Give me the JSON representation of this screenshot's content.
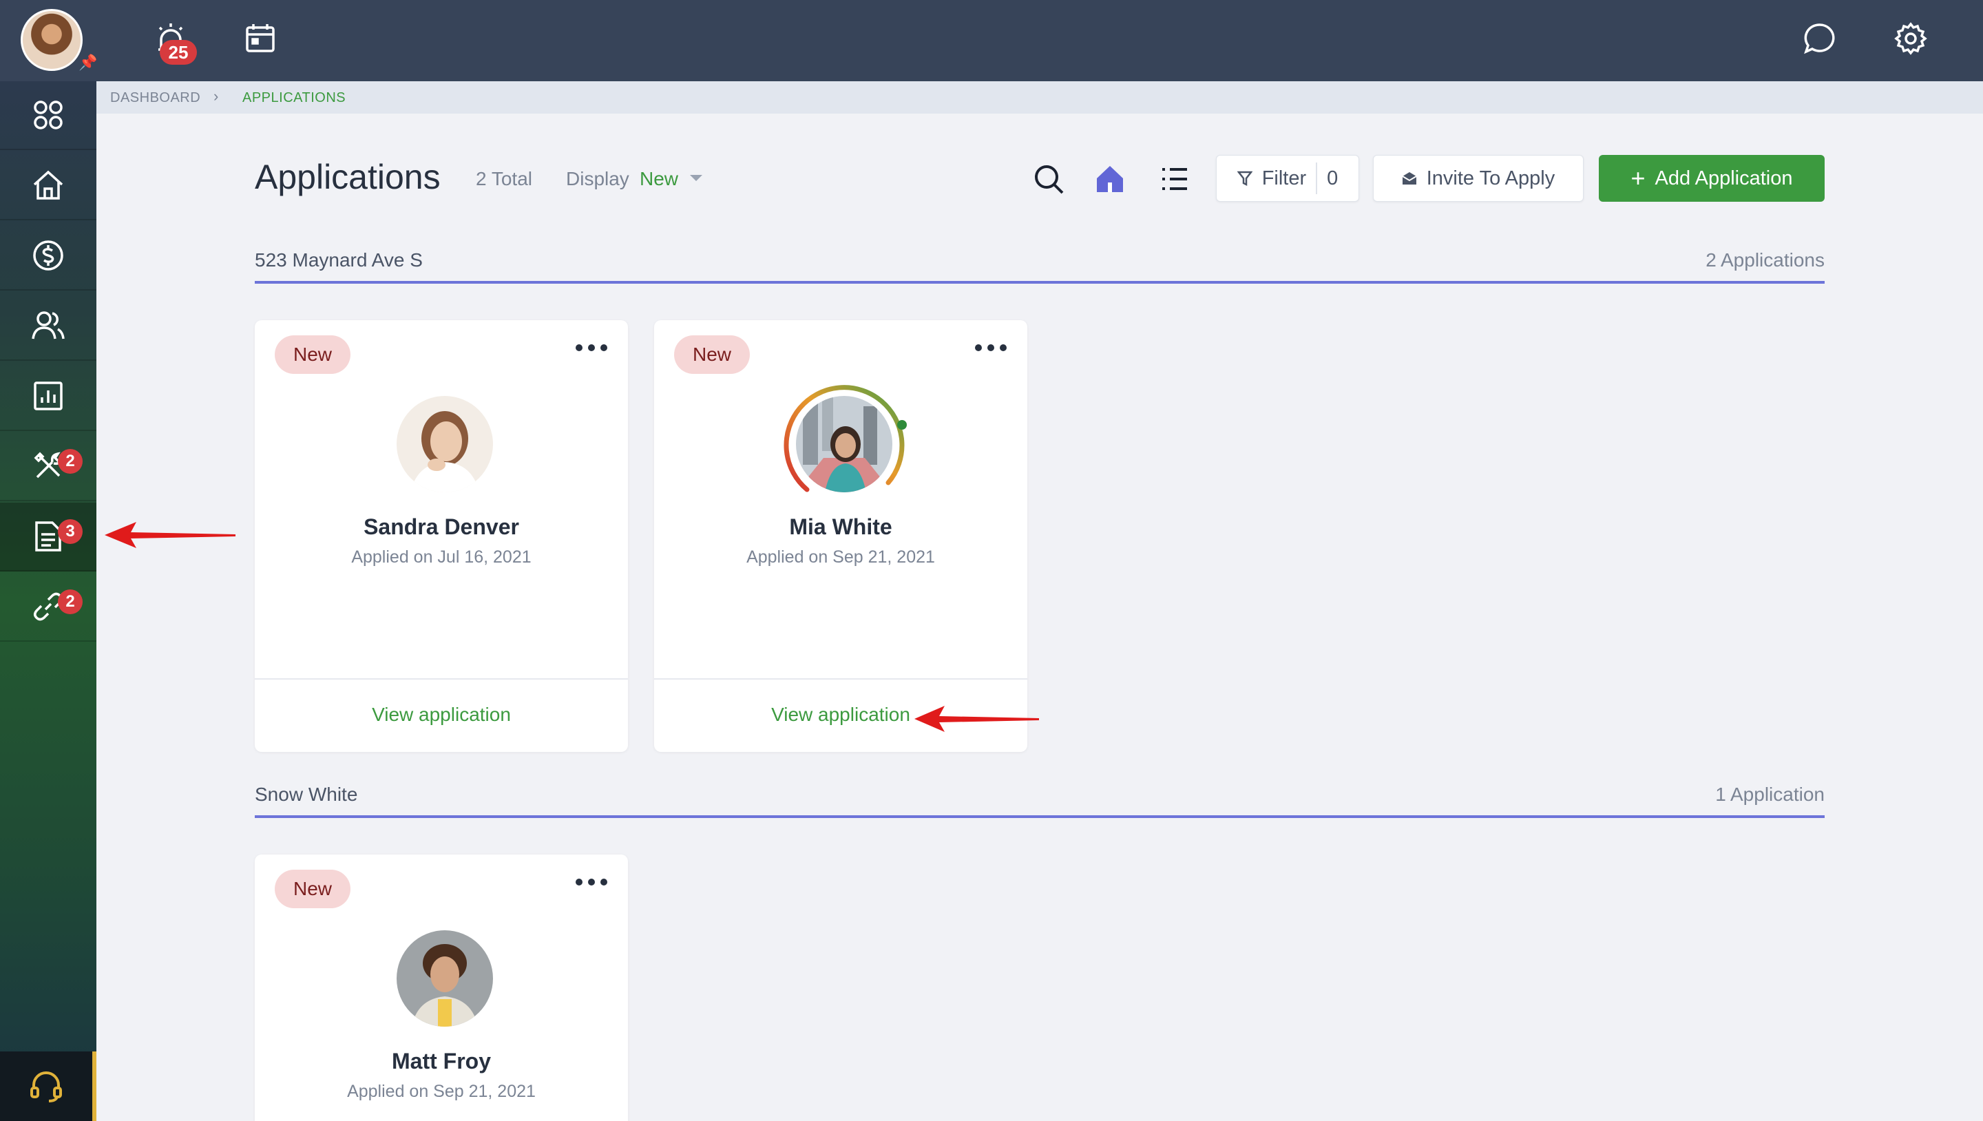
{
  "topbar": {
    "notifications_count": "25",
    "icons": [
      "alarm-icon",
      "calendar-icon",
      "chat-icon",
      "gear-icon"
    ]
  },
  "sidebar": {
    "items": [
      {
        "name": "apps",
        "icon": "grid-icon"
      },
      {
        "name": "home",
        "icon": "home-icon"
      },
      {
        "name": "payments",
        "icon": "dollar-icon"
      },
      {
        "name": "people",
        "icon": "people-icon"
      },
      {
        "name": "reports",
        "icon": "chart-icon"
      },
      {
        "name": "maintenance",
        "icon": "tools-icon",
        "badge": "2"
      },
      {
        "name": "applications",
        "icon": "document-icon",
        "badge": "3",
        "active": true
      },
      {
        "name": "links",
        "icon": "link-icon",
        "badge": "2"
      }
    ],
    "support_icon": "headset-icon"
  },
  "breadcrumb": {
    "items": [
      "DASHBOARD",
      "APPLICATIONS"
    ],
    "separator": "›"
  },
  "header": {
    "title": "Applications",
    "total": "2 Total",
    "display_label": "Display",
    "display_value": "New",
    "filter_label": "Filter",
    "filter_count": "0",
    "invite_label": "Invite To Apply",
    "add_label": "Add Application",
    "add_plus": "+"
  },
  "groups": [
    {
      "title": "523 Maynard Ave S",
      "count": "2 Applications",
      "cards": [
        {
          "status": "New",
          "name": "Sandra Denver",
          "applied": "Applied on Jul 16, 2021",
          "link": "View application"
        },
        {
          "status": "New",
          "name": "Mia White",
          "applied": "Applied on Sep 21, 2021",
          "link": "View application",
          "score_ring": true
        }
      ]
    },
    {
      "title": "Snow White",
      "count": "1 Application",
      "cards": [
        {
          "status": "New",
          "name": "Matt Froy",
          "applied": "Applied on Sep 21, 2021"
        }
      ]
    }
  ],
  "colors": {
    "accent_green": "#3c9a3f",
    "topbar": "#374459",
    "group_line": "#6d74d9",
    "badge_red": "#d73b3e",
    "annotation_arrow": "#e01b1b"
  }
}
